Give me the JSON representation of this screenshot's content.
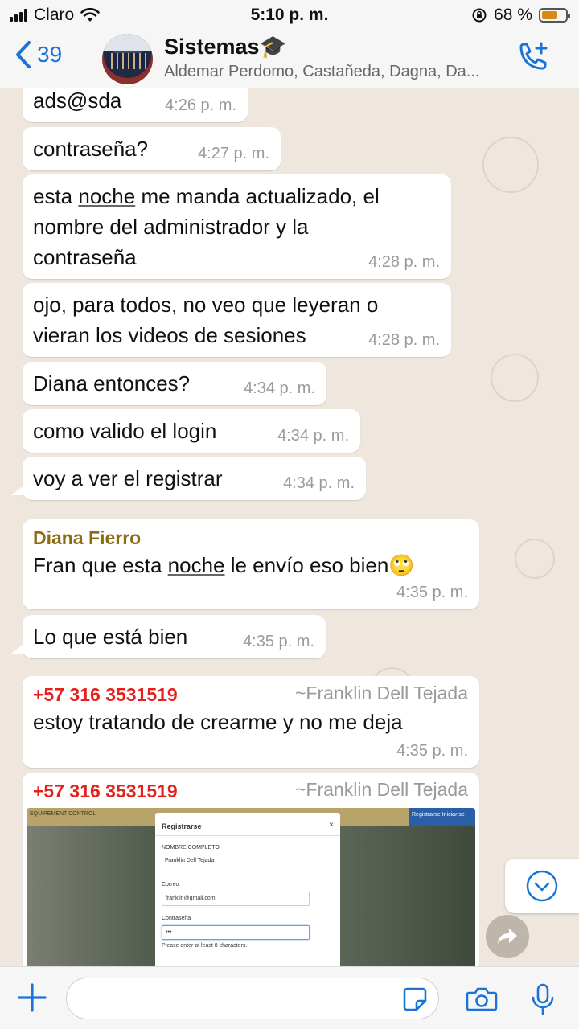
{
  "status_bar": {
    "carrier": "Claro",
    "time": "5:10 p. m.",
    "battery_percent": "68 %",
    "battery_level": 0.68,
    "icons": [
      "signal-icon",
      "wifi-icon",
      "orientation-lock-icon",
      "battery-icon"
    ]
  },
  "header": {
    "back_count": "39",
    "title": "Sistemas",
    "title_emoji": "🎓",
    "subtitle": "Aldemar Perdomo, Castañeda, Dagna, Da...",
    "icons": [
      "chevron-left-icon",
      "group-avatar",
      "add-call-icon"
    ]
  },
  "messages": [
    {
      "id": 1,
      "pre": "ads@sda",
      "time": "4:26 p. m."
    },
    {
      "id": 2,
      "pre": "contraseña?",
      "time": "4:27 p. m."
    },
    {
      "id": 3,
      "pre": "esta ",
      "underlined": "noche",
      "post": " me manda actualizado, el",
      "line2": "nombre del administrador y la",
      "line3": "contraseña",
      "time": "4:28 p. m."
    },
    {
      "id": 4,
      "pre": "ojo, para todos, no veo que leyeran o",
      "line2": "vieran los videos de sesiones",
      "time": "4:28 p. m."
    },
    {
      "id": 5,
      "pre": "Diana entonces?",
      "time": "4:34 p. m."
    },
    {
      "id": 6,
      "pre": "como valido el login",
      "time": "4:34 p. m."
    },
    {
      "id": 7,
      "pre": "voy a ver el registrar",
      "time": "4:34 p. m."
    },
    {
      "id": 8,
      "sender": "Diana Fierro",
      "pre": "Fran que esta ",
      "underlined": "noche",
      "post": " le envío eso bien",
      "emoji": "🙄",
      "time": "4:35 p. m."
    },
    {
      "id": 9,
      "pre": "Lo que está bien",
      "time": "4:35 p. m."
    },
    {
      "id": 10,
      "sender": "+57 316 3531519",
      "alias": "~Franklin Dell Tejada",
      "pre": "estoy tratando de crearme y no me deja",
      "time": "4:35 p. m."
    },
    {
      "id": 11,
      "sender": "+57 316 3531519",
      "alias": "~Franklin Dell Tejada",
      "type": "image"
    }
  ],
  "image_preview": {
    "app_bar": "EQUIPEMENT CONTROL",
    "nav_links": "Registrarse   Iniciar se",
    "modal_title": "Registrarse",
    "close": "×",
    "label_name": "NOMBRE COMPLETO",
    "value_name": "Franklin Dell Tejada",
    "label_email": "Correo",
    "value_email": "franklin@gmail.com",
    "label_password": "Contraseña",
    "value_password": "•••",
    "hint": "Please enter at least 8 characters."
  },
  "input_bar": {
    "placeholder": "",
    "icons": [
      "plus-icon",
      "sticker-icon",
      "camera-icon",
      "microphone-icon"
    ]
  },
  "colors": {
    "accent": "#1a73d9",
    "sender_diana": "#8a6d10",
    "sender_franklin": "#e5201d",
    "chat_bg": "#efe7de",
    "battery": "#d98a12"
  }
}
